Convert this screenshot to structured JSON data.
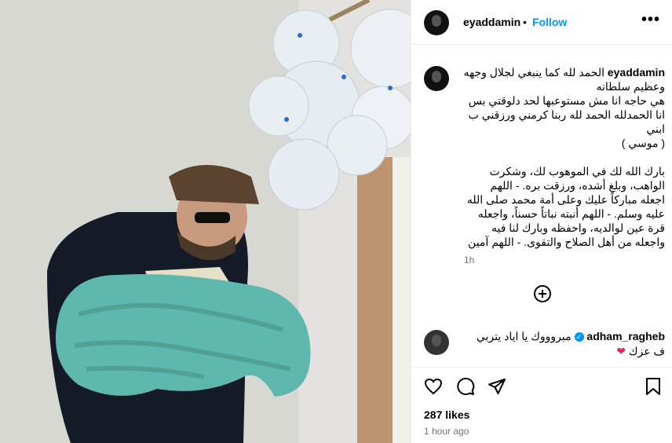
{
  "post": {
    "author": "eyaddamin",
    "follow_label": "Follow",
    "separator": "•",
    "more_label": "•••"
  },
  "caption": {
    "username": "eyaddamin",
    "text": "الحمد لله كما ينبغي لجلال وجهه وعظيم سلطانه\nهي حاجه انا مش مستوعبها لحد دلوقتي بس انا الحمدلله الحمد لله ربنا كرمني ورزقني ب ابني\n( موسي )\n\nبارك الله لك في الموهوب لك، وشكرت الواهب، وبلغ أشده، ورزقت بره. - اللهم اجعله مباركاً عليك وعلى أمة محمد صلى الله عليه وسلم. - اللهم أنبته نباتاً حسناً، واجعله قرة عين لوالديه، واحفظه وبارك لنا فيه واجعله من أهل الصلاح والتقوى. - اللهم آمين",
    "time": "1h"
  },
  "comment": {
    "username": "adham_ragheb",
    "verified_mark": "✓",
    "text": "مبروووك يا اياد يتربي ف عزك",
    "heart": "❤"
  },
  "actions": {
    "likes": "287 likes",
    "posted": "1 hour ago"
  },
  "colors": {
    "follow": "#0095f6",
    "verified": "#0095f6",
    "heart": "#e0245e",
    "blanket": "#5fb8ad",
    "balloon": "#e8eef4"
  },
  "icons": [
    "heart-icon",
    "comment-icon",
    "share-icon",
    "bookmark-icon",
    "add-comment-icon",
    "more-icon"
  ]
}
